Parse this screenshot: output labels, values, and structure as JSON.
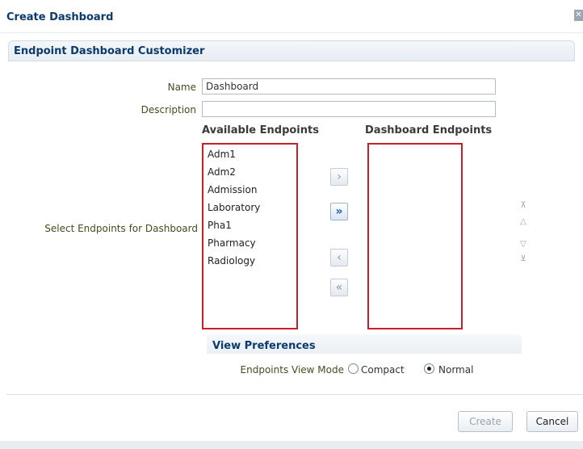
{
  "dialog": {
    "title": "Create Dashboard",
    "close_icon": "close-icon"
  },
  "customizer": {
    "title": "Endpoint Dashboard Customizer",
    "name_label": "Name",
    "name_value": "Dashboard",
    "description_label": "Description",
    "description_value": "",
    "select_label": "Select Endpoints for Dashboard",
    "available_header": "Available Endpoints",
    "dashboard_header": "Dashboard Endpoints",
    "available_items": [
      "Adm1",
      "Adm2",
      "Admission",
      "Laboratory",
      "Pha1",
      "Pharmacy",
      "Radiology"
    ],
    "dashboard_items": [],
    "shuttle": {
      "move_icon": "chevron-right-icon",
      "move_all_icon": "double-chevron-right-icon",
      "remove_icon": "chevron-left-icon",
      "remove_all_icon": "double-chevron-left-icon"
    },
    "reorder": {
      "top_icon": "move-to-top-icon",
      "up_icon": "move-up-icon",
      "down_icon": "move-down-icon",
      "bottom_icon": "move-to-bottom-icon"
    }
  },
  "view_preferences": {
    "title": "View Preferences",
    "mode_label": "Endpoints View Mode",
    "options": [
      "Compact",
      "Normal"
    ],
    "selected": "Normal"
  },
  "footer": {
    "create_label": "Create",
    "cancel_label": "Cancel"
  },
  "colors": {
    "accent": "#0b3a6e",
    "list_border": "#c8202a",
    "label": "#4a4a20"
  }
}
